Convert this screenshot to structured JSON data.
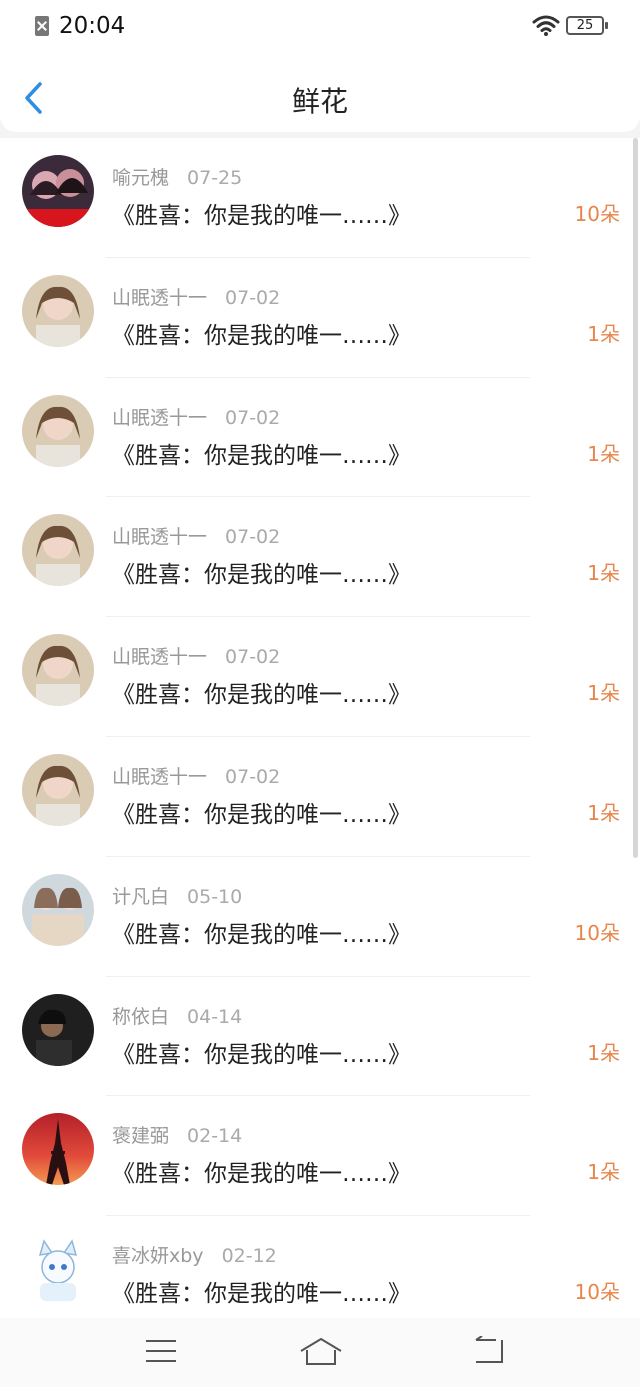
{
  "status": {
    "time": "20:04",
    "battery": "25"
  },
  "header": {
    "title": "鲜花"
  },
  "records": [
    {
      "user": "喻元槐",
      "date": "07-25",
      "book": "《胜喜：你是我的唯一……》",
      "count": "10朵",
      "avatar": "couple-photo-avatar"
    },
    {
      "user": "山眠透十一",
      "date": "07-02",
      "book": "《胜喜：你是我的唯一……》",
      "count": "1朵",
      "avatar": "girl-portrait-avatar"
    },
    {
      "user": "山眠透十一",
      "date": "07-02",
      "book": "《胜喜：你是我的唯一……》",
      "count": "1朵",
      "avatar": "girl-portrait-avatar"
    },
    {
      "user": "山眠透十一",
      "date": "07-02",
      "book": "《胜喜：你是我的唯一……》",
      "count": "1朵",
      "avatar": "girl-portrait-avatar"
    },
    {
      "user": "山眠透十一",
      "date": "07-02",
      "book": "《胜喜：你是我的唯一……》",
      "count": "1朵",
      "avatar": "girl-portrait-avatar"
    },
    {
      "user": "山眠透十一",
      "date": "07-02",
      "book": "《胜喜：你是我的唯一……》",
      "count": "1朵",
      "avatar": "girl-portrait-avatar"
    },
    {
      "user": "计凡白",
      "date": "05-10",
      "book": "《胜喜：你是我的唯一……》",
      "count": "10朵",
      "avatar": "two-girls-avatar"
    },
    {
      "user": "称依白",
      "date": "04-14",
      "book": "《胜喜：你是我的唯一……》",
      "count": "1朵",
      "avatar": "dark-portrait-avatar"
    },
    {
      "user": "褒建弼",
      "date": "02-14",
      "book": "《胜喜：你是我的唯一……》",
      "count": "1朵",
      "avatar": "eiffel-tower-avatar"
    },
    {
      "user": "喜冰妍xby",
      "date": "02-12",
      "book": "《胜喜：你是我的唯一……》",
      "count": "10朵",
      "avatar": "anime-cat-avatar"
    }
  ],
  "colors": {
    "accent": "#e8854a",
    "back_icon": "#2f8de4"
  }
}
